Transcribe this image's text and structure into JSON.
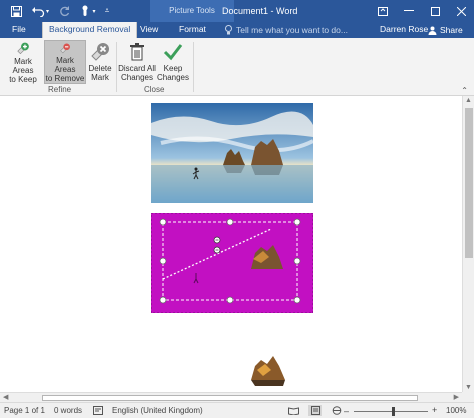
{
  "window": {
    "contextual_group": "Picture Tools",
    "document_title": "Document1 - Word"
  },
  "tabs": {
    "file": "File",
    "background_removal": "Background Removal",
    "view": "View",
    "format": "Format"
  },
  "tell_me": {
    "placeholder": "Tell me what you want to do..."
  },
  "user": {
    "name": "Darren Rose",
    "share": "Share"
  },
  "ribbon": {
    "refine": {
      "label": "Refine",
      "mark_keep": {
        "line1": "Mark Areas",
        "line2": "to Keep"
      },
      "mark_remove": {
        "line1": "Mark Areas",
        "line2": "to Remove"
      },
      "delete_mark": {
        "line1": "Delete",
        "line2": "Mark"
      }
    },
    "close": {
      "label": "Close",
      "discard": {
        "line1": "Discard All",
        "line2": "Changes"
      },
      "keep": {
        "line1": "Keep",
        "line2": "Changes"
      }
    }
  },
  "status": {
    "page": "Page 1 of 1",
    "words": "0 words",
    "language": "English (United Kingdom)",
    "zoom": "100%"
  },
  "colors": {
    "accent": "#2b579a",
    "removal_overlay": "#c210c2",
    "keep_green": "#3c9f5a",
    "remove_red": "#d9534f"
  }
}
